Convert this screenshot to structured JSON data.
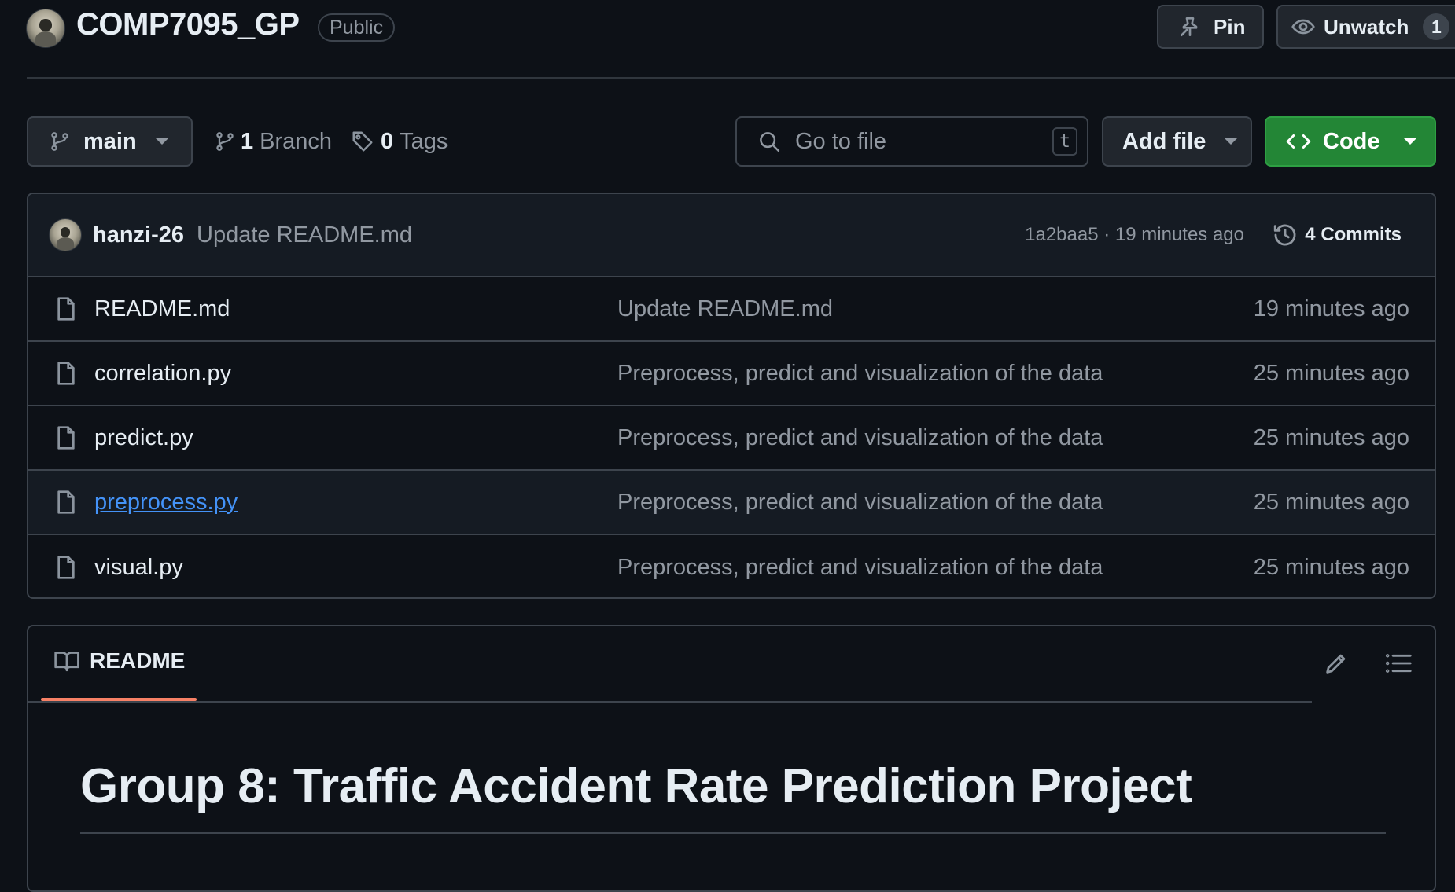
{
  "repo": {
    "name": "COMP7095_GP",
    "visibility": "Public"
  },
  "header_actions": {
    "pin_label": "Pin",
    "unwatch_label": "Unwatch",
    "watch_count": "1"
  },
  "toolbar": {
    "branch": "main",
    "branch_count": "1",
    "branch_label": "Branch",
    "tag_count": "0",
    "tag_label": "Tags",
    "search_placeholder": "Go to file",
    "search_shortcut": "t",
    "add_file_label": "Add file",
    "code_label": "Code"
  },
  "latest_commit": {
    "author": "hanzi-26",
    "message": "Update README.md",
    "meta": "1a2baa5 · 19 minutes ago",
    "commits_label": "4 Commits"
  },
  "files": [
    {
      "name": "README.md",
      "message": "Update README.md",
      "age": "19 minutes ago"
    },
    {
      "name": "correlation.py",
      "message": "Preprocess, predict and visualization of the data",
      "age": "25 minutes ago"
    },
    {
      "name": "predict.py",
      "message": "Preprocess, predict and visualization of the data",
      "age": "25 minutes ago"
    },
    {
      "name": "preprocess.py",
      "message": "Preprocess, predict and visualization of the data",
      "age": "25 minutes ago"
    },
    {
      "name": "visual.py",
      "message": "Preprocess, predict and visualization of the data",
      "age": "25 minutes ago"
    }
  ],
  "readme": {
    "tab_label": "README",
    "title": "Group 8: Traffic Accident Rate Prediction Project"
  },
  "icons": {
    "pin": "pin-icon",
    "eye": "eye-icon",
    "branch": "git-branch-icon",
    "tag": "tag-icon",
    "search": "search-icon",
    "code": "code-icon",
    "history": "history-icon",
    "file": "file-icon",
    "book": "book-icon",
    "pencil": "pencil-icon",
    "outline": "list-icon"
  },
  "colors": {
    "background": "#0d1117",
    "code_button": "#238636",
    "active_tab_underline": "#f78166",
    "link": "#4493f8"
  }
}
